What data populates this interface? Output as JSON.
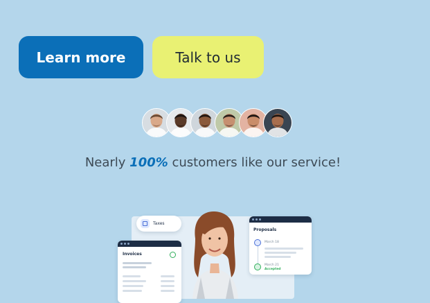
{
  "buttons": {
    "learn_more": "Learn more",
    "talk_to_us": "Talk to us"
  },
  "avatars": [
    {
      "name": "avatar-1",
      "skin": "#d9a98a",
      "hair": "#6b4a34",
      "bg": "#d7dde2"
    },
    {
      "name": "avatar-2",
      "skin": "#5a3a28",
      "hair": "#1c1310",
      "bg": "#e6e9ec"
    },
    {
      "name": "avatar-3",
      "skin": "#8a5a3c",
      "hair": "#221712",
      "bg": "#cfd6dc"
    },
    {
      "name": "avatar-4",
      "skin": "#c69070",
      "hair": "#2a201a",
      "bg": "#bfc9a8"
    },
    {
      "name": "avatar-5",
      "skin": "#c98d6a",
      "hair": "#1e1512",
      "bg": "#e3b3a2"
    },
    {
      "name": "avatar-6",
      "skin": "#a86e4e",
      "hair": "#201612",
      "bg": "#3a4552"
    }
  ],
  "tagline": {
    "before": "Nearly ",
    "highlight": "100%",
    "after": " customers like our service!"
  },
  "illustration": {
    "taxes_label": "Taxes",
    "invoices_label": "Invoices",
    "proposals_label": "Proposals",
    "proposal_date_1": "March 18",
    "proposal_date_2": "March 21",
    "proposal_status": "Accepted"
  },
  "colors": {
    "background": "#b4d6eb",
    "primary": "#0b6fb8",
    "secondary": "#e9f173",
    "accent_green": "#2fae5a"
  }
}
